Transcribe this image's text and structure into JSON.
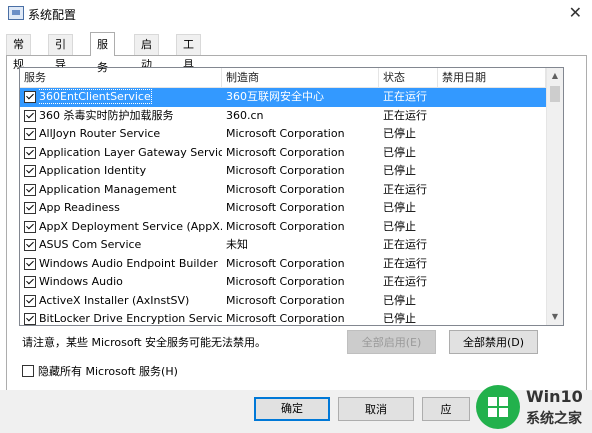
{
  "window": {
    "title": "系统配置",
    "close": "✕"
  },
  "tabs": [
    {
      "label": "常规",
      "active": false
    },
    {
      "label": "引导",
      "active": false
    },
    {
      "label": "服务",
      "active": true
    },
    {
      "label": "启动",
      "active": false
    },
    {
      "label": "工具",
      "active": false
    }
  ],
  "table": {
    "headers": [
      "服务",
      "制造商",
      "状态",
      "禁用日期"
    ],
    "rows": [
      {
        "name": "360EntClientService",
        "maker": "360互联网安全中心",
        "status": "正在运行",
        "checked": true,
        "selected": true
      },
      {
        "name": "360 杀毒实时防护加载服务",
        "maker": "360.cn",
        "status": "正在运行",
        "checked": true
      },
      {
        "name": "AllJoyn Router Service",
        "maker": "Microsoft Corporation",
        "status": "已停止",
        "checked": true
      },
      {
        "name": "Application Layer Gateway Service",
        "maker": "Microsoft Corporation",
        "status": "已停止",
        "checked": true
      },
      {
        "name": "Application Identity",
        "maker": "Microsoft Corporation",
        "status": "已停止",
        "checked": true
      },
      {
        "name": "Application Management",
        "maker": "Microsoft Corporation",
        "status": "正在运行",
        "checked": true
      },
      {
        "name": "App Readiness",
        "maker": "Microsoft Corporation",
        "status": "已停止",
        "checked": true
      },
      {
        "name": "AppX Deployment Service (AppX...",
        "maker": "Microsoft Corporation",
        "status": "已停止",
        "checked": true
      },
      {
        "name": "ASUS Com Service",
        "maker": "未知",
        "status": "正在运行",
        "checked": true
      },
      {
        "name": "Windows Audio Endpoint Builder",
        "maker": "Microsoft Corporation",
        "status": "正在运行",
        "checked": true
      },
      {
        "name": "Windows Audio",
        "maker": "Microsoft Corporation",
        "status": "正在运行",
        "checked": true
      },
      {
        "name": "ActiveX Installer (AxInstSV)",
        "maker": "Microsoft Corporation",
        "status": "已停止",
        "checked": true
      },
      {
        "name": "BitLocker Drive Encryption Service",
        "maker": "Microsoft Corporation",
        "status": "已停止",
        "checked": true
      }
    ]
  },
  "note": "请注意，某些 Microsoft 安全服务可能无法禁用。",
  "buttons": {
    "enable_all": "全部启用(E)",
    "disable_all": "全部禁用(D)",
    "ok": "确定",
    "cancel": "取消",
    "apply": "应"
  },
  "hide_ms_label": "隐藏所有 Microsoft 服务(H)",
  "watermark": {
    "line1": "Win10",
    "line2": "系统之家"
  },
  "colors": {
    "selection": "#3399ff",
    "primary_border": "#0078d7",
    "watermark_green": "#22b14c"
  }
}
